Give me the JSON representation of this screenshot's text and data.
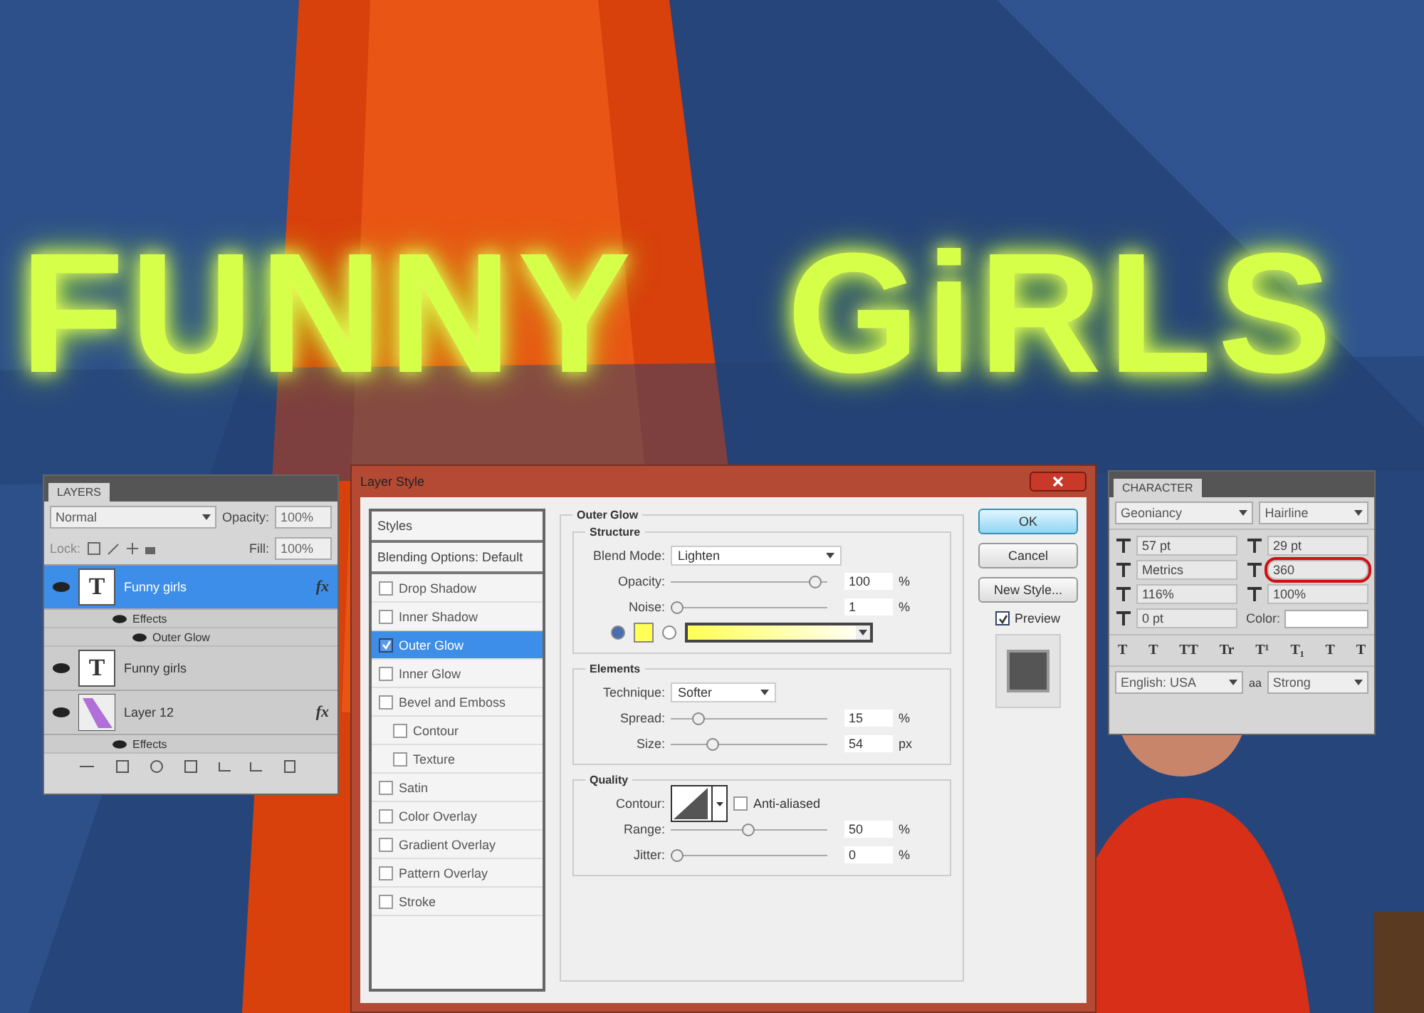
{
  "canvas": {
    "headline": "FUNNY GiRLS"
  },
  "layers_panel": {
    "tab": "LAYERS",
    "blend_mode": "Normal",
    "opacity_label": "Opacity:",
    "opacity": "100%",
    "lock_label": "Lock:",
    "fill_label": "Fill:",
    "fill": "100%",
    "layers": [
      {
        "kind": "text",
        "thumb": "T",
        "name": "Funny girls",
        "selected": true,
        "badge": "fx",
        "effects_label": "Effects",
        "effects": [
          "Outer Glow"
        ]
      },
      {
        "kind": "text",
        "thumb": "T",
        "name": "Funny girls",
        "selected": false
      },
      {
        "name": "Layer 12",
        "selected": false,
        "badge": "fx",
        "effects_label": "Effects"
      }
    ]
  },
  "dialog": {
    "title": "Layer Style",
    "styles_header": "Styles",
    "blending_options": "Blending Options: Default",
    "styles": [
      {
        "label": "Drop Shadow",
        "checked": false,
        "selected": false
      },
      {
        "label": "Inner Shadow",
        "checked": false,
        "selected": false
      },
      {
        "label": "Outer Glow",
        "checked": true,
        "selected": true
      },
      {
        "label": "Inner Glow",
        "checked": false,
        "selected": false
      },
      {
        "label": "Bevel and Emboss",
        "checked": false,
        "selected": false,
        "children": [
          {
            "label": "Contour",
            "checked": false,
            "selected": false
          },
          {
            "label": "Texture",
            "checked": false,
            "selected": false
          }
        ]
      },
      {
        "label": "Satin",
        "checked": false,
        "selected": false
      },
      {
        "label": "Color Overlay",
        "checked": false,
        "selected": false
      },
      {
        "label": "Gradient Overlay",
        "checked": false,
        "selected": false
      },
      {
        "label": "Pattern Overlay",
        "checked": false,
        "selected": false
      },
      {
        "label": "Stroke",
        "checked": false,
        "selected": false
      }
    ],
    "section_title": "Outer Glow",
    "structure": {
      "title": "Structure",
      "blend_mode_label": "Blend Mode:",
      "blend_mode": "Lighten",
      "sliders": [
        {
          "label": "Opacity:",
          "level": 0.97,
          "value": "100",
          "unit": "%"
        },
        {
          "label": "Noise:",
          "level": 0.0,
          "value": "1",
          "unit": "%"
        }
      ],
      "fill_options": [
        {
          "kind": "color",
          "selected": true,
          "color": "#ffff55"
        },
        {
          "kind": "gradient",
          "selected": false,
          "color": "#ffff55"
        }
      ]
    },
    "elements": {
      "title": "Elements",
      "technique_label": "Technique:",
      "technique": "Softer",
      "sliders": [
        {
          "label": "Spread:",
          "level": 0.15,
          "value": "15",
          "unit": "%"
        },
        {
          "label": "Size:",
          "level": 0.25,
          "value": "54",
          "unit": "px"
        }
      ]
    },
    "quality": {
      "title": "Quality",
      "contour_label": "Contour:",
      "anti_aliased": {
        "label": "Anti-aliased",
        "checked": false
      },
      "sliders": [
        {
          "label": "Range:",
          "level": 0.5,
          "value": "50",
          "unit": "%"
        },
        {
          "label": "Jitter:",
          "level": 0.0,
          "value": "0",
          "unit": "%"
        }
      ]
    },
    "buttons": [
      {
        "label": "OK",
        "default": true
      },
      {
        "label": "Cancel",
        "default": false
      },
      {
        "label": "New Style...",
        "default": false
      }
    ],
    "preview": {
      "label": "Preview",
      "checked": true
    }
  },
  "character_panel": {
    "tab": "CHARACTER",
    "font": "Geoniancy",
    "style": "Hairline",
    "fields": [
      {
        "value": "57 pt",
        "highlighted": false
      },
      {
        "value": "29 pt",
        "highlighted": false
      },
      {
        "value": "Metrics",
        "highlighted": false
      },
      {
        "value": "360",
        "highlighted": true
      },
      {
        "value": "116%",
        "highlighted": false
      },
      {
        "value": "100%",
        "highlighted": false
      },
      {
        "value": "0 pt",
        "highlighted": false
      }
    ],
    "color_label": "Color:",
    "type_styles": [
      "T",
      "T",
      "TT",
      "Tr",
      "T¹",
      "T₁",
      "T",
      "T"
    ],
    "language": "English: USA",
    "aa_label": "aa",
    "anti_alias": "Strong"
  }
}
